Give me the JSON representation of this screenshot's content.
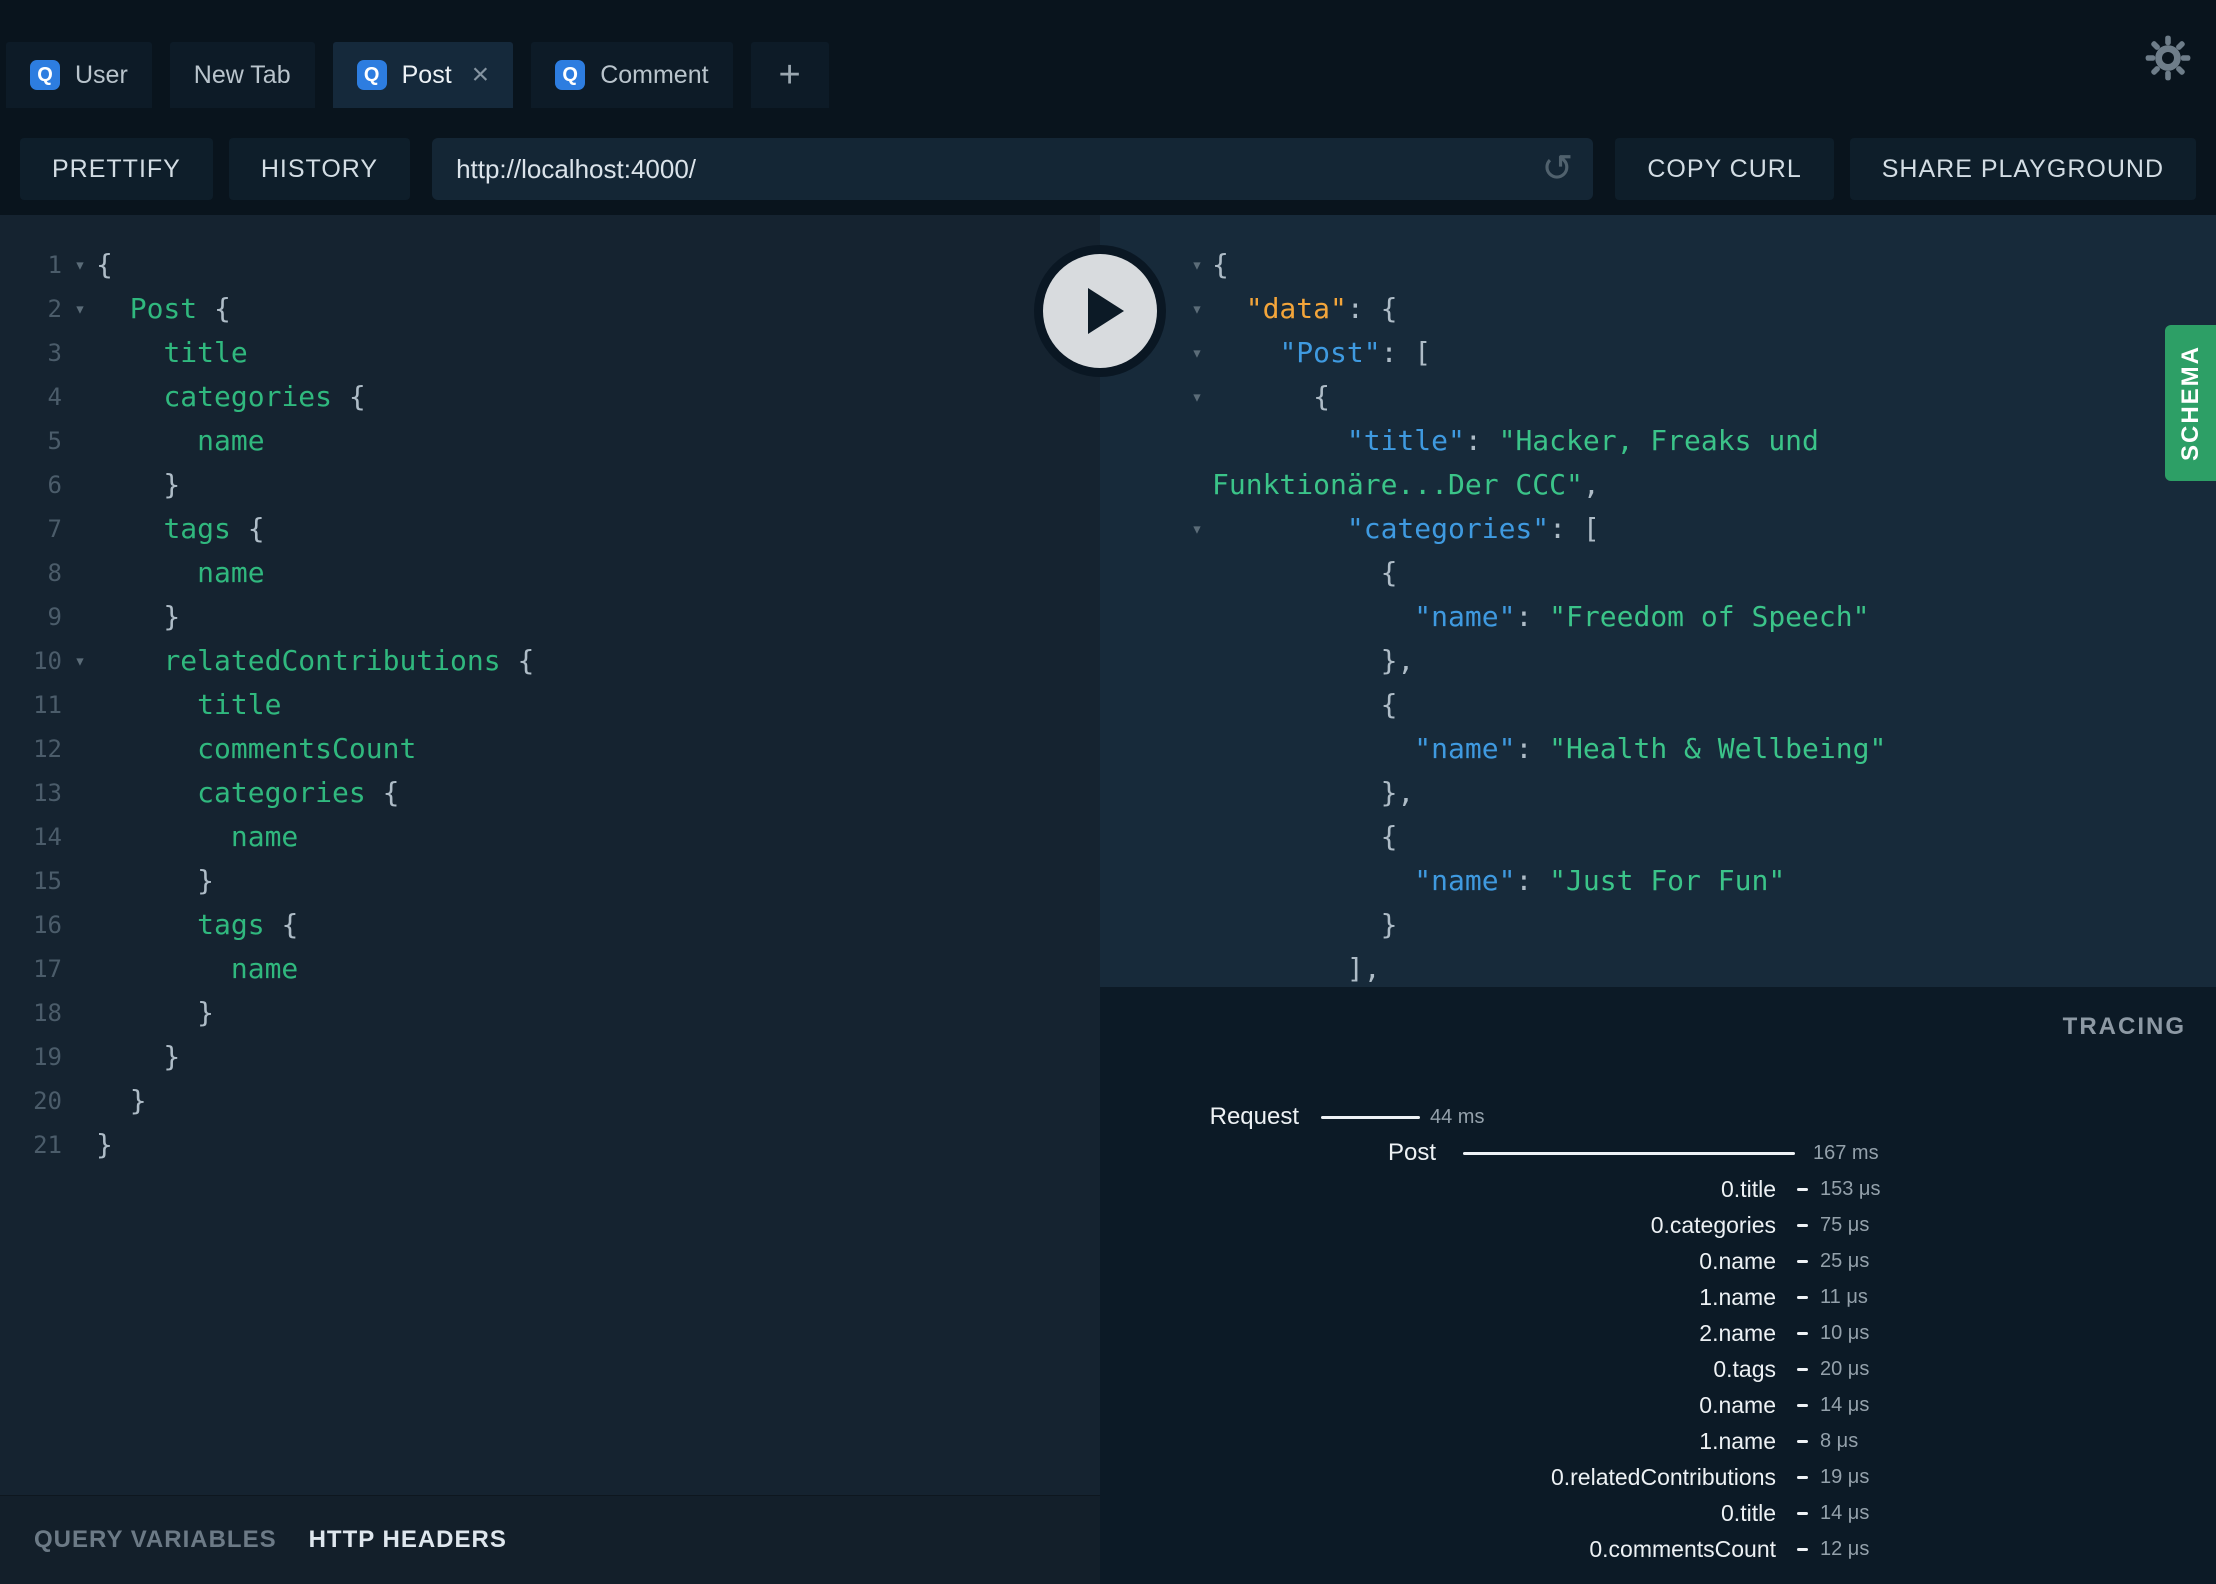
{
  "colors": {
    "topbar-bg": "#09141d",
    "tab-bg": "#0d1b27",
    "tab-active-bg": "#15293b",
    "badge-blue": "#2d7de0",
    "button-bg": "#0e1e2a",
    "url-bg": "#142635",
    "editor-bg": "#152330",
    "response-bg": "#172a3a",
    "tracing-bg": "#0c1a26",
    "footer-bg": "#131f2a",
    "schema-green": "#2d9f66",
    "field-green": "#30b87e",
    "string-green": "#3bc489",
    "key-blue": "#3f9ae0",
    "key-orange": "#f3a53a",
    "punctuation": "#aebcc7"
  },
  "icons": {
    "close": "×",
    "plus": "+",
    "reload": "↺",
    "fold": "▾"
  },
  "topbar": {
    "tabs": [
      {
        "badge": "Q",
        "label": "User"
      },
      {
        "label": "New Tab"
      },
      {
        "badge": "Q",
        "label": "Post"
      },
      {
        "badge": "Q",
        "label": "Comment"
      }
    ]
  },
  "toolbar": {
    "prettify": "PRETTIFY",
    "history": "HISTORY",
    "url": "http://localhost:4000/",
    "copy_curl": "COPY CURL",
    "share": "SHARE PLAYGROUND"
  },
  "editor": {
    "lines": [
      {
        "n": 1,
        "fold": true,
        "tokens": [
          [
            "p",
            "{"
          ]
        ]
      },
      {
        "n": 2,
        "fold": true,
        "tokens": [
          [
            "p",
            "  "
          ],
          [
            "f",
            "Post"
          ],
          [
            "p",
            " {"
          ]
        ]
      },
      {
        "n": 3,
        "tokens": [
          [
            "p",
            "    "
          ],
          [
            "f",
            "title"
          ]
        ]
      },
      {
        "n": 4,
        "tokens": [
          [
            "p",
            "    "
          ],
          [
            "f",
            "categories"
          ],
          [
            "p",
            " {"
          ]
        ]
      },
      {
        "n": 5,
        "tokens": [
          [
            "p",
            "      "
          ],
          [
            "f",
            "name"
          ]
        ]
      },
      {
        "n": 6,
        "tokens": [
          [
            "p",
            "    }"
          ]
        ]
      },
      {
        "n": 7,
        "tokens": [
          [
            "p",
            "    "
          ],
          [
            "f",
            "tags"
          ],
          [
            "p",
            " {"
          ]
        ]
      },
      {
        "n": 8,
        "tokens": [
          [
            "p",
            "      "
          ],
          [
            "f",
            "name"
          ]
        ]
      },
      {
        "n": 9,
        "tokens": [
          [
            "p",
            "    }"
          ]
        ]
      },
      {
        "n": 10,
        "fold": true,
        "tokens": [
          [
            "p",
            "    "
          ],
          [
            "f",
            "relatedContributions"
          ],
          [
            "p",
            " {"
          ]
        ]
      },
      {
        "n": 11,
        "tokens": [
          [
            "p",
            "      "
          ],
          [
            "f",
            "title"
          ]
        ]
      },
      {
        "n": 12,
        "tokens": [
          [
            "p",
            "      "
          ],
          [
            "f",
            "commentsCount"
          ]
        ]
      },
      {
        "n": 13,
        "tokens": [
          [
            "p",
            "      "
          ],
          [
            "f",
            "categories"
          ],
          [
            "p",
            " {"
          ]
        ]
      },
      {
        "n": 14,
        "tokens": [
          [
            "p",
            "        "
          ],
          [
            "f",
            "name"
          ]
        ]
      },
      {
        "n": 15,
        "tokens": [
          [
            "p",
            "      }"
          ]
        ]
      },
      {
        "n": 16,
        "tokens": [
          [
            "p",
            "      "
          ],
          [
            "f",
            "tags"
          ],
          [
            "p",
            " {"
          ]
        ]
      },
      {
        "n": 17,
        "tokens": [
          [
            "p",
            "        "
          ],
          [
            "f",
            "name"
          ]
        ]
      },
      {
        "n": 18,
        "tokens": [
          [
            "p",
            "      }"
          ]
        ]
      },
      {
        "n": 19,
        "tokens": [
          [
            "p",
            "    }"
          ]
        ]
      },
      {
        "n": 20,
        "tokens": [
          [
            "p",
            "  }"
          ]
        ]
      },
      {
        "n": 21,
        "tokens": [
          [
            "p",
            "}"
          ]
        ]
      }
    ],
    "footer": {
      "query_variables": "QUERY VARIABLES",
      "http_headers": "HTTP HEADERS"
    }
  },
  "response": {
    "lines": [
      {
        "fold": true,
        "tokens": [
          [
            "p",
            "{"
          ]
        ]
      },
      {
        "fold": true,
        "tokens": [
          [
            "p",
            "  "
          ],
          [
            "d",
            "\"data\""
          ],
          [
            "p",
            ": {"
          ]
        ]
      },
      {
        "fold": true,
        "tokens": [
          [
            "p",
            "    "
          ],
          [
            "k",
            "\"Post\""
          ],
          [
            "p",
            ": ["
          ]
        ]
      },
      {
        "fold": true,
        "tokens": [
          [
            "p",
            "      {"
          ]
        ]
      },
      {
        "tokens": [
          [
            "p",
            "        "
          ],
          [
            "k",
            "\"title\""
          ],
          [
            "p",
            ": "
          ],
          [
            "s",
            "\"Hacker, Freaks und Funktionäre...Der CCC\""
          ],
          [
            "p",
            ","
          ]
        ]
      },
      {
        "fold": true,
        "tokens": [
          [
            "p",
            "        "
          ],
          [
            "k",
            "\"categories\""
          ],
          [
            "p",
            ": ["
          ]
        ]
      },
      {
        "tokens": [
          [
            "p",
            "          {"
          ]
        ]
      },
      {
        "tokens": [
          [
            "p",
            "            "
          ],
          [
            "k",
            "\"name\""
          ],
          [
            "p",
            ": "
          ],
          [
            "s",
            "\"Freedom of Speech\""
          ]
        ]
      },
      {
        "tokens": [
          [
            "p",
            "          },"
          ]
        ]
      },
      {
        "tokens": [
          [
            "p",
            "          {"
          ]
        ]
      },
      {
        "tokens": [
          [
            "p",
            "            "
          ],
          [
            "k",
            "\"name\""
          ],
          [
            "p",
            ": "
          ],
          [
            "s",
            "\"Health & Wellbeing\""
          ]
        ]
      },
      {
        "tokens": [
          [
            "p",
            "          },"
          ]
        ]
      },
      {
        "tokens": [
          [
            "p",
            "          {"
          ]
        ]
      },
      {
        "tokens": [
          [
            "p",
            "            "
          ],
          [
            "k",
            "\"name\""
          ],
          [
            "p",
            ": "
          ],
          [
            "s",
            "\"Just For Fun\""
          ]
        ]
      },
      {
        "tokens": [
          [
            "p",
            "          }"
          ]
        ]
      },
      {
        "tokens": [
          [
            "p",
            "        ],"
          ]
        ]
      }
    ]
  },
  "tracing": {
    "title": "TRACING",
    "rows": [
      {
        "level": 0,
        "label": "Request",
        "time": "44 ms"
      },
      {
        "level": 1,
        "label": "Post",
        "time": "167 ms"
      },
      {
        "level": 2,
        "label": "0.title",
        "time": "153 μs"
      },
      {
        "level": 2,
        "label": "0.categories",
        "time": "75 μs"
      },
      {
        "level": 2,
        "label": "0.name",
        "time": "25 μs"
      },
      {
        "level": 2,
        "label": "1.name",
        "time": "11 μs"
      },
      {
        "level": 2,
        "label": "2.name",
        "time": "10 μs"
      },
      {
        "level": 2,
        "label": "0.tags",
        "time": "20 μs"
      },
      {
        "level": 2,
        "label": "0.name",
        "time": "14 μs"
      },
      {
        "level": 2,
        "label": "1.name",
        "time": "8 μs"
      },
      {
        "level": 2,
        "label": "0.relatedContributions",
        "time": "19 μs"
      },
      {
        "level": 2,
        "label": "0.title",
        "time": "14 μs"
      },
      {
        "level": 2,
        "label": "0.commentsCount",
        "time": "12 μs"
      }
    ]
  },
  "schema_tab": "SCHEMA"
}
